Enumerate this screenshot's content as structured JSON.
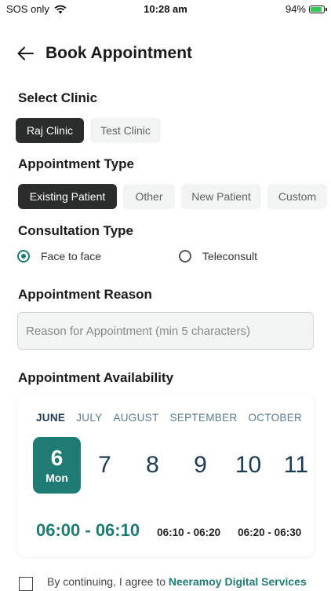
{
  "status_bar": {
    "carrier": "SOS only",
    "time": "10:28 am",
    "battery": "94%",
    "battery_level": 0.94
  },
  "header": {
    "title": "Book Appointment"
  },
  "clinic": {
    "title": "Select Clinic",
    "options": [
      "Raj Clinic",
      "Test Clinic"
    ],
    "selected": "Raj Clinic"
  },
  "appointment_type": {
    "title": "Appointment Type",
    "options": [
      "Existing Patient",
      "Other",
      "New Patient",
      "Custom"
    ],
    "selected": "Existing Patient"
  },
  "consultation_type": {
    "title": "Consultation Type",
    "options": [
      "Face to face",
      "Teleconsult"
    ],
    "selected": "Face to face"
  },
  "reason": {
    "title": "Appointment Reason",
    "placeholder": "Reason for Appointment (min 5 characters)",
    "value": ""
  },
  "availability": {
    "title": "Appointment Availability",
    "months": [
      "JUNE",
      "JULY",
      "AUGUST",
      "SEPTEMBER",
      "OCTOBER"
    ],
    "selected_month": "JUNE",
    "dates": [
      {
        "num": "6",
        "day": "Mon"
      },
      {
        "num": "7"
      },
      {
        "num": "8"
      },
      {
        "num": "9"
      },
      {
        "num": "10"
      },
      {
        "num": "11"
      }
    ],
    "selected_date": "6",
    "slots": [
      "06:00 - 06:10",
      "06:10 - 06:20",
      "06:20 - 06:30"
    ],
    "selected_slot": "06:00 - 06:10"
  },
  "agreement": {
    "text": "By continuing, I agree to ",
    "link": "Neeramoy Digital Services"
  },
  "colors": {
    "accent": "#1f7c75",
    "dark_chip": "#2b2d2d",
    "month_dark": "#1d3b55"
  }
}
